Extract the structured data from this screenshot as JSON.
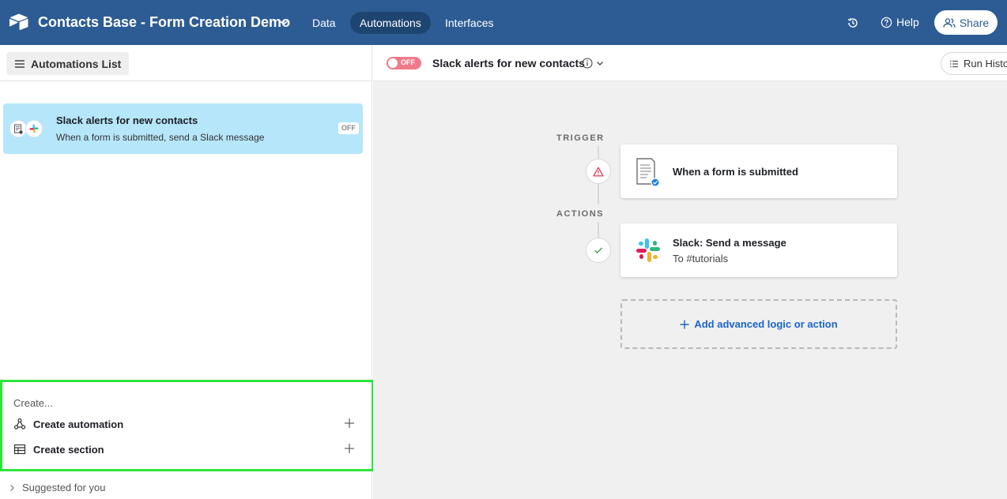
{
  "topbar": {
    "base_title": "Contacts Base - Form Creation Demo",
    "tabs": [
      {
        "label": "Data"
      },
      {
        "label": "Automations"
      },
      {
        "label": "Interfaces"
      }
    ],
    "help_label": "Help",
    "share_label": "Share"
  },
  "sidebar": {
    "header_button": "Automations List",
    "automation": {
      "title": "Slack alerts for new contacts",
      "subtitle": "When a form is submitted, send a Slack message",
      "status": "OFF"
    },
    "create": {
      "label": "Create...",
      "items": [
        {
          "label": "Create automation",
          "icon": "automation-icon"
        },
        {
          "label": "Create section",
          "icon": "table-icon"
        }
      ]
    },
    "suggested_label": "Suggested for you"
  },
  "editor": {
    "toggle_label": "OFF",
    "automation_name": "Slack alerts for new contacts",
    "run_history_label": "Run Histo",
    "trigger_label": "TRIGGER",
    "actions_label": "ACTIONS",
    "trigger": {
      "title": "When a form is submitted",
      "status_icon": "warning-icon"
    },
    "action": {
      "title": "Slack: Send a message",
      "subtitle": "To #tutorials",
      "status_icon": "check-icon"
    },
    "add_label": "Add advanced logic or action"
  },
  "colors": {
    "topbar": "#2d5c94",
    "selected_card": "#b6e6fa",
    "highlight_border": "#2fe33c",
    "toggle_off": "#f07a8a",
    "link": "#1a65c9"
  }
}
